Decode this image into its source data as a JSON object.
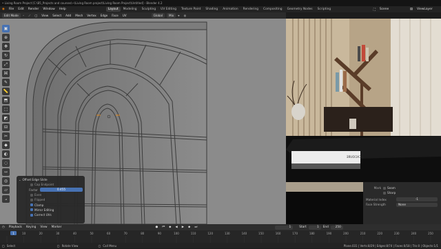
{
  "window": {
    "title": "• Living Room Project [C:\\B5_Projects and courses\\~\\Living Room project\\Living Room Project\\Untitled] - Blender 4.2"
  },
  "menu": {
    "items": [
      "File",
      "Edit",
      "Render",
      "Window",
      "Help"
    ]
  },
  "workspaces": {
    "tabs": [
      "Layout",
      "Modeling",
      "Sculpting",
      "UV Editing",
      "Texture Paint",
      "Shading",
      "Animation",
      "Rendering",
      "Compositing",
      "Geometry Nodes",
      "Scripting"
    ],
    "active": "Layout"
  },
  "top_right": {
    "scene": "Scene",
    "view_layer": "ViewLayer"
  },
  "viewport_header": {
    "mode": "Edit Mode",
    "menus": [
      "View",
      "Select",
      "Add",
      "Mesh",
      "Vertex",
      "Edge",
      "Face",
      "UV"
    ],
    "orientation": "Global",
    "pivot": "Mix"
  },
  "operator_panel": {
    "title": "Offset Edge Slide",
    "options": [
      {
        "label": "Cap Endpoint",
        "checked": false
      },
      {
        "label": "Even",
        "checked": false
      },
      {
        "label": "Flipped",
        "checked": false
      },
      {
        "label": "Clamp",
        "checked": true
      },
      {
        "label": "Mirror Editing",
        "checked": true
      },
      {
        "label": "Correct UVs",
        "checked": true
      }
    ],
    "factor_label": "Factor",
    "factor_value": "0.455"
  },
  "properties": {
    "mark_label": "Mark",
    "seam": "Seam",
    "sharp": "Sharp",
    "material_index_label": "Material Index",
    "material_index": "-1",
    "face_strength_label": "Face Strength",
    "face_strength": "None"
  },
  "timeline": {
    "menus": [
      "Playback",
      "Keying",
      "View",
      "Marker"
    ],
    "current_frame": "1",
    "start_label": "Start",
    "start": "1",
    "end_label": "End",
    "end": "250",
    "ticks": [
      "0",
      "10",
      "20",
      "30",
      "40",
      "50",
      "60",
      "70",
      "80",
      "90",
      "100",
      "110",
      "120",
      "130",
      "140",
      "150",
      "160",
      "170",
      "180",
      "190",
      "200",
      "210",
      "220",
      "230",
      "240",
      "250"
    ]
  },
  "status_bar": {
    "left": [
      "Select",
      "Rotate View",
      "Call Menu"
    ],
    "stats": "Plane.031 | Verts:8/29 | Edges:8/74 | Faces:0/18 | Tris:0 | Objects:1/1"
  },
  "colors": {
    "accent": "#4772b3",
    "viewport_bg": "#8a8a8a",
    "panel_bg": "#2a2a2a"
  }
}
